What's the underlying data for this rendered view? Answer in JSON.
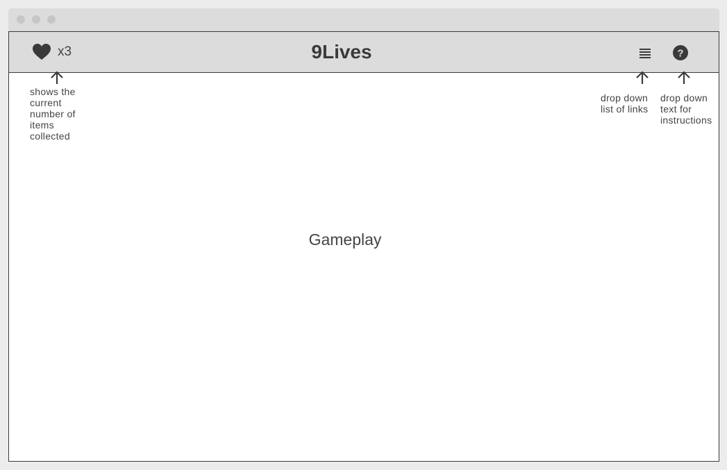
{
  "app": {
    "title": "9Lives",
    "lives_count": "x3"
  },
  "header": {
    "icons": [
      "heart-icon",
      "menu-icon",
      "help-icon"
    ]
  },
  "annotations": {
    "lives_note": [
      "shows the",
      "current",
      "number of",
      "items",
      "collected"
    ],
    "menu_note": [
      "drop down",
      "list of links"
    ],
    "help_note": [
      "drop down",
      "text for",
      "instructions"
    ]
  },
  "main": {
    "placeholder": "Gameplay"
  },
  "colors": {
    "chrome": "#dcdcdc",
    "border": "#3a3a3a",
    "text": "#444444",
    "background": "#ffffff"
  }
}
